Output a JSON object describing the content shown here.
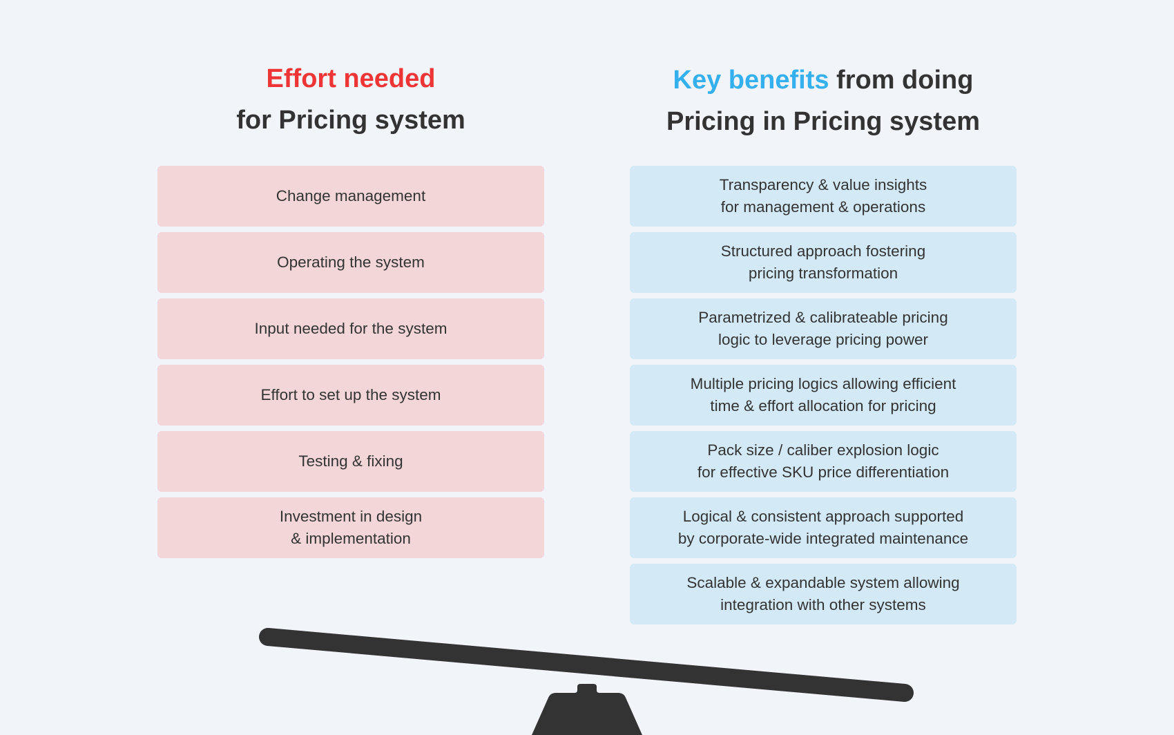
{
  "left": {
    "title_accent": "Effort needed",
    "title_line2": "for Pricing system",
    "accent_color": "#ee3434",
    "items": [
      "Change management",
      "Operating the system",
      "Input needed for the system",
      "Effort to set up the system",
      "Testing & fixing",
      "Investment in design\n& implementation"
    ]
  },
  "right": {
    "title_accent": "Key benefits",
    "title_rest": " from doing",
    "title_line2": "Pricing in Pricing system",
    "accent_color": "#35b0ee",
    "items": [
      "Transparency & value insights\nfor management & operations",
      "Structured approach fostering\npricing transformation",
      "Parametrized & calibrateable pricing\nlogic to leverage pricing power",
      "Multiple pricing logics allowing efficient\ntime & effort allocation for pricing",
      "Pack size / caliber explosion logic\nfor effective SKU price differentiation",
      "Logical & consistent approach supported\nby corporate-wide integrated maintenance",
      "Scalable & expandable system allowing\nintegration with other systems"
    ]
  },
  "seesaw": {
    "tilt": "right side lower",
    "color": "#333333"
  }
}
